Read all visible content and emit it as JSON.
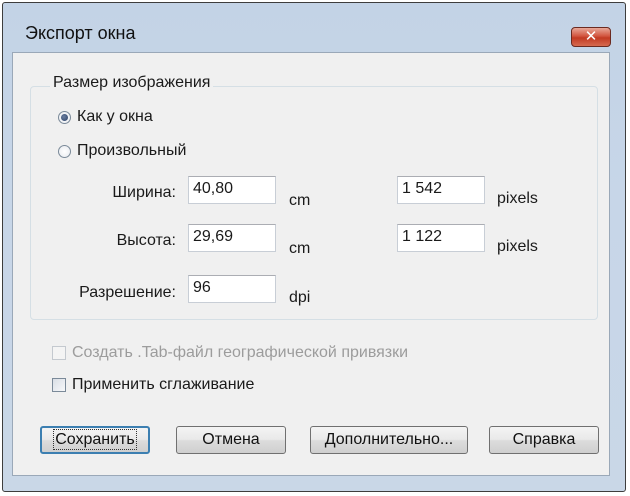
{
  "window": {
    "title": "Экспорт окна",
    "close_glyph": "✕"
  },
  "image_size": {
    "group_title": "Размер изображения",
    "options": [
      {
        "label": "Как у окна",
        "selected": true
      },
      {
        "label": "Произвольный",
        "selected": false
      }
    ],
    "width": {
      "label": "Ширина:",
      "cm_value": "40,80",
      "cm_unit": "cm",
      "px_value": "1 542",
      "px_unit": "pixels"
    },
    "height": {
      "label": "Высота:",
      "cm_value": "29,69",
      "cm_unit": "cm",
      "px_value": "1 122",
      "px_unit": "pixels"
    },
    "resolution": {
      "label": "Разрешение:",
      "value": "96",
      "unit": "dpi"
    }
  },
  "options": {
    "create_tab": {
      "label": "Создать .Tab-файл географической привязки",
      "checked": false,
      "enabled": false
    },
    "smoothing": {
      "label": "Применить сглаживание",
      "checked": false,
      "enabled": true
    }
  },
  "buttons": {
    "save": "Сохранить",
    "cancel": "Отмена",
    "advanced": "Дополнительно...",
    "help": "Справка"
  },
  "colors": {
    "title_bar": "#c3d3e6",
    "close_button": "#c23a23",
    "dialog_bg": "#f0f0f0",
    "default_button_border": "#3c7fb1"
  },
  "icons": {
    "close": "close-icon",
    "radio_selected": "radio-selected-icon",
    "radio_unselected": "radio-unselected-icon",
    "checkbox": "checkbox-icon"
  }
}
